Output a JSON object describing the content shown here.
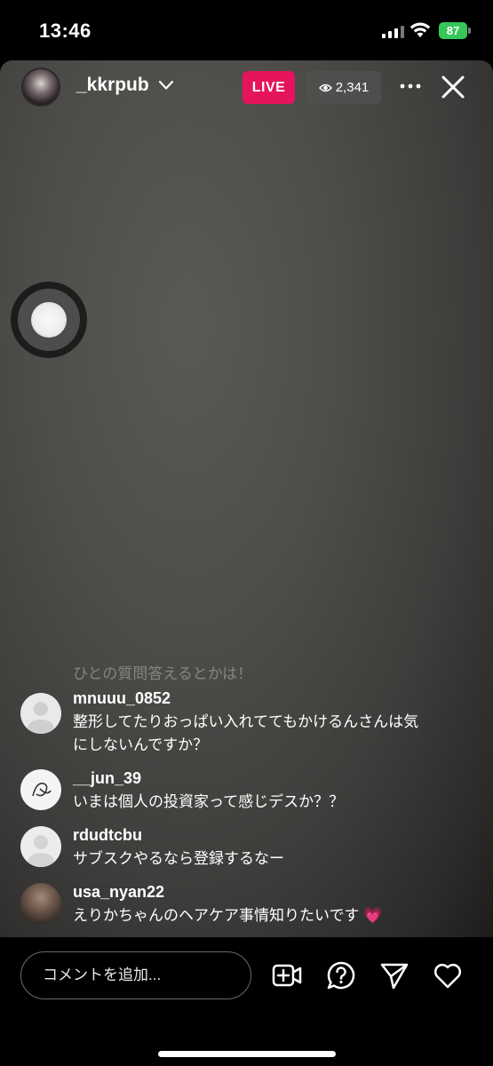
{
  "status_bar": {
    "time": "13:46",
    "battery": "87"
  },
  "live": {
    "username": "_kkrpub",
    "live_label": "LIVE",
    "viewers": "2,341"
  },
  "comments": {
    "faded_text": "ひとの質問答えるとかは！",
    "items": [
      {
        "user": "mnuuu_0852",
        "text": "整形してたりおっぱい入れててもかけるんさんは気にしないんですか？"
      },
      {
        "user": "__jun_39",
        "text": "いまは個人の投資家って感じデスか？？"
      },
      {
        "user": "rdudtcbu",
        "text": "サブスクやるなら登録するなー"
      },
      {
        "user": "usa_nyan22",
        "text": "えりかちゃんのヘアケア事情知りたいです 💗"
      }
    ]
  },
  "bottom": {
    "comment_placeholder": "コメントを追加..."
  },
  "colors": {
    "live_badge": "#e6145d",
    "battery": "#35c759"
  }
}
